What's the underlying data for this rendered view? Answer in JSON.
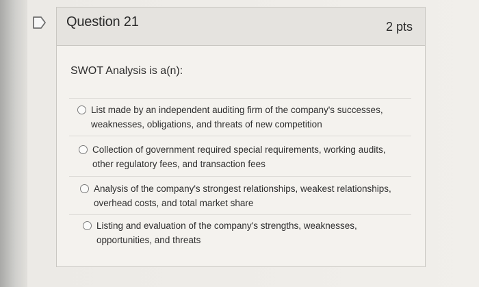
{
  "question": {
    "title": "Question 21",
    "points": "2 pts",
    "prompt": "SWOT Analysis is a(n):"
  },
  "answers": [
    {
      "label": "List made by an independent auditing firm of the company's successes, weaknesses, obligations, and threats of new competition"
    },
    {
      "label": "Collection of government required special requirements, working audits, other regulatory fees, and transaction fees"
    },
    {
      "label": "Analysis of the company's strongest relationships, weakest relationships, overhead costs, and total market share"
    },
    {
      "label": "Listing and evaluation of the company's strengths, weaknesses, opportunities, and threats"
    }
  ],
  "icons": {
    "flag": "flag-icon"
  },
  "colors": {
    "header_bg": "#e5e3df",
    "card_bg": "#f4f2ee",
    "border": "#c9c7c2",
    "text": "#2a2a2a"
  }
}
